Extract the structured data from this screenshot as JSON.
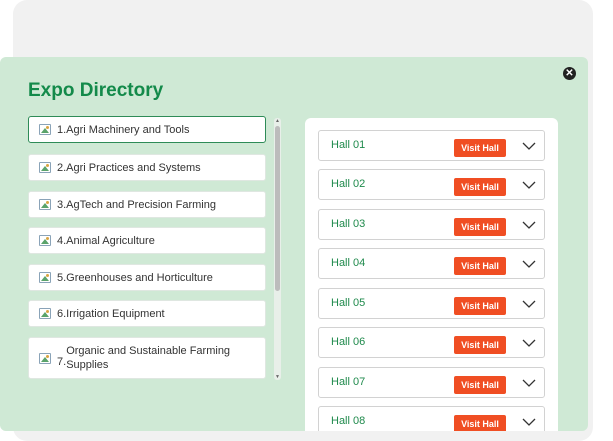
{
  "modal": {
    "title": "Expo Directory",
    "close_icon": "close-icon"
  },
  "categories": [
    {
      "label": "1.Agri Machinery and Tools",
      "active": true
    },
    {
      "label": "2.Agri Practices and Systems"
    },
    {
      "label": "3.AgTech and Precision Farming"
    },
    {
      "label": "4.Animal Agriculture"
    },
    {
      "label": "5.Greenhouses and Horticulture"
    },
    {
      "label": "6.Irrigation Equipment"
    },
    {
      "label_num": "7.",
      "label": "Organic and Sustainable Farming Supplies"
    }
  ],
  "halls": [
    {
      "name": "Hall 01",
      "button": "Visit Hall"
    },
    {
      "name": "Hall 02",
      "button": "Visit Hall"
    },
    {
      "name": "Hall 03",
      "button": "Visit Hall"
    },
    {
      "name": "Hall 04",
      "button": "Visit Hall"
    },
    {
      "name": "Hall 05",
      "button": "Visit Hall"
    },
    {
      "name": "Hall 06",
      "button": "Visit Hall"
    },
    {
      "name": "Hall 07",
      "button": "Visit Hall"
    },
    {
      "name": "Hall 08",
      "button": "Visit Hall"
    }
  ],
  "colors": {
    "modal_bg": "#cfe9d5",
    "title": "#138a4a",
    "hall_text": "#1f8a4c",
    "visit_button": "#f04e23"
  }
}
